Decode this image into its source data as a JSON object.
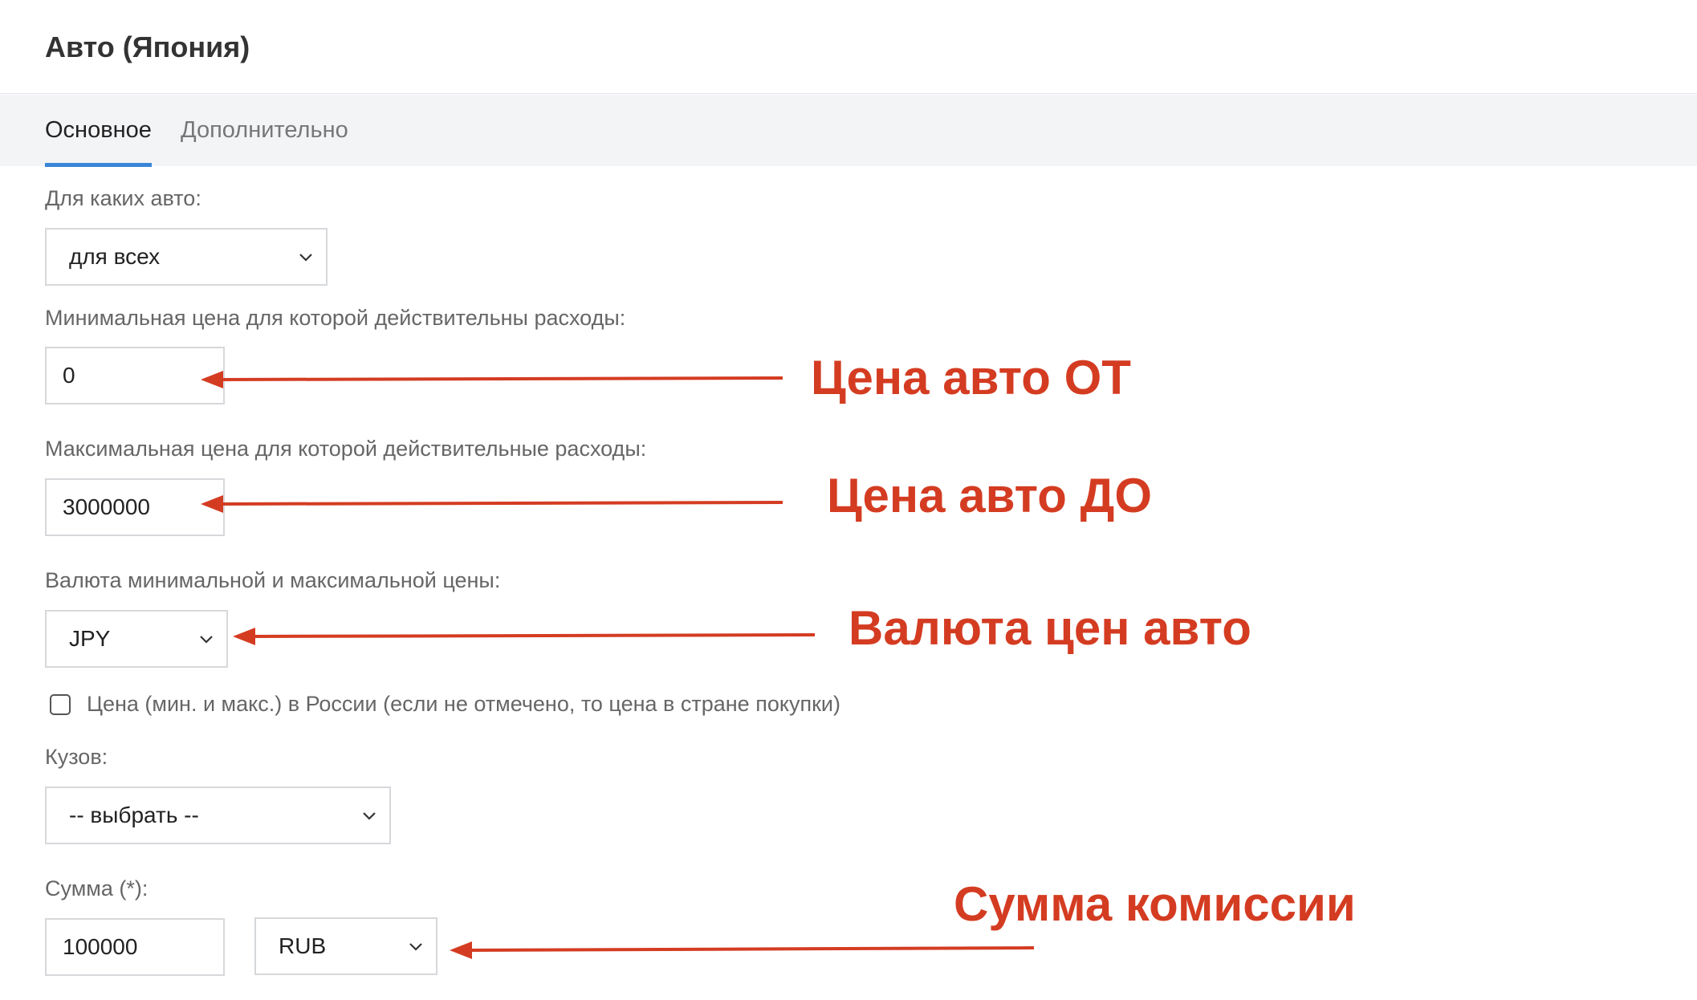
{
  "header": {
    "title": "Авто (Япония)"
  },
  "tabs": [
    {
      "label": "Основное",
      "active": true
    },
    {
      "label": "Дополнительно",
      "active": false
    }
  ],
  "form": {
    "cars_for_label": "Для каких авто:",
    "cars_for_value": "для всех",
    "min_price_label": "Минимальная цена для которой действительны расходы:",
    "min_price_value": "0",
    "max_price_label": "Максимальная цена для которой действительные расходы:",
    "max_price_value": "3000000",
    "currency_label": "Валюта минимальной и максимальной цены:",
    "currency_value": "JPY",
    "russia_price_checkbox_label": "Цена (мин. и макс.) в России (если не отмечено, то цена в стране покупки)",
    "russia_price_checked": false,
    "body_label": "Кузов:",
    "body_value": "-- выбрать --",
    "sum_label": "Сумма (*):",
    "sum_value": "100000",
    "sum_currency_value": "RUB"
  },
  "annotations": {
    "price_from": "Цена авто ОТ",
    "price_to": "Цена авто ДО",
    "price_currency": "Валюта цен авто",
    "commission_sum": "Сумма комиссии"
  },
  "icons": {
    "select": "chevron-down-icon",
    "arrow": "arrow-left-icon"
  },
  "colors": {
    "accent_tab": "#3a86d8",
    "annotation": "#d43c22",
    "tabs_bg": "#f3f4f6",
    "field_border": "#d6d8db"
  }
}
